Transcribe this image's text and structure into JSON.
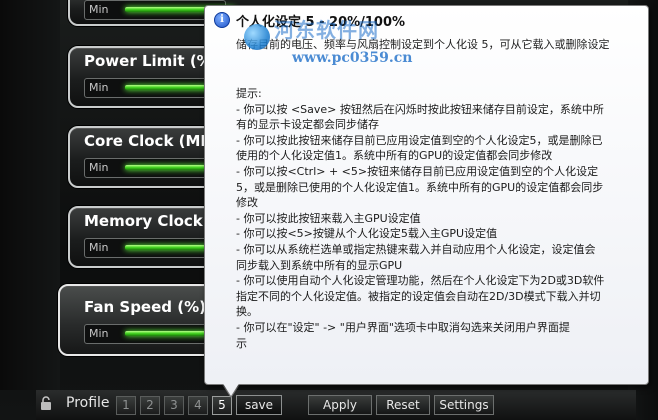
{
  "panels": [
    {
      "title": "",
      "slider_min": "Min"
    },
    {
      "title": "Power Limit (%",
      "slider_min": "Min"
    },
    {
      "title": "Core Clock (MH",
      "slider_min": "Min"
    },
    {
      "title": "Memory Clock",
      "slider_min": "Min"
    },
    {
      "title": "Fan Speed (%)",
      "slider_min": "Min"
    }
  ],
  "bottom": {
    "profile_label": "Profile",
    "profiles": [
      "1",
      "2",
      "3",
      "4",
      "5"
    ],
    "active_profile": "5",
    "save_label": "save",
    "apply_label": "Apply",
    "reset_label": "Reset",
    "settings_label": "Settings"
  },
  "tooltip": {
    "title": "个人化设定 5 - 20%/100%",
    "subtitle": "储存目前的电压、频率与风扇控制设定到个人化设 5，可从它载入或删除设定",
    "body": [
      "提示:",
      "- 你可以按 <Save> 按钮然后在闪烁时按此按钮来储存目前设定，系统中所",
      "有的显示卡设定都会同步储存",
      "- 你可以按此按钮来储存目前已应用设定值到空的个人化设定5，或是删除已",
      "使用的个人化设定值1。系统中所有的GPU的设定值都会同步修改",
      "- 你可以按<Ctrl> + <5>按钮来储存目前已应用设定值到空的个人化设定",
      "5，或是删除已使用的个人化设定值1。系统中所有的GPU的设定值都会同步",
      "修改",
      "- 你可以按此按钮来载入主GPU设定值",
      "- 你可以按<5>按键从个人化设定5载入主GPU设定值",
      "- 你可以从系统栏选单或指定热键来载入并自动应用个人化设定，设定值会",
      "同步载入到系统中所有的显示GPU",
      "- 你可以使用自动个人化设定管理功能，然后在个人化设定下为2D或3D软件",
      "指定不同的个人化设定值。被指定的设定值会自动在2D/3D模式下载入并切",
      "换。",
      "- 你可以在\"设定\" -> \"用户界面\"选项卡中取消勾选来关闭用户界面提",
      "示"
    ]
  },
  "watermark": {
    "line1": "河东软件网",
    "line2": "www.pc0359.cn"
  },
  "colors": {
    "slider_glow": "#3fd21e",
    "tooltip_bg": "#ffffff",
    "watermark": "#1e6ec8"
  }
}
